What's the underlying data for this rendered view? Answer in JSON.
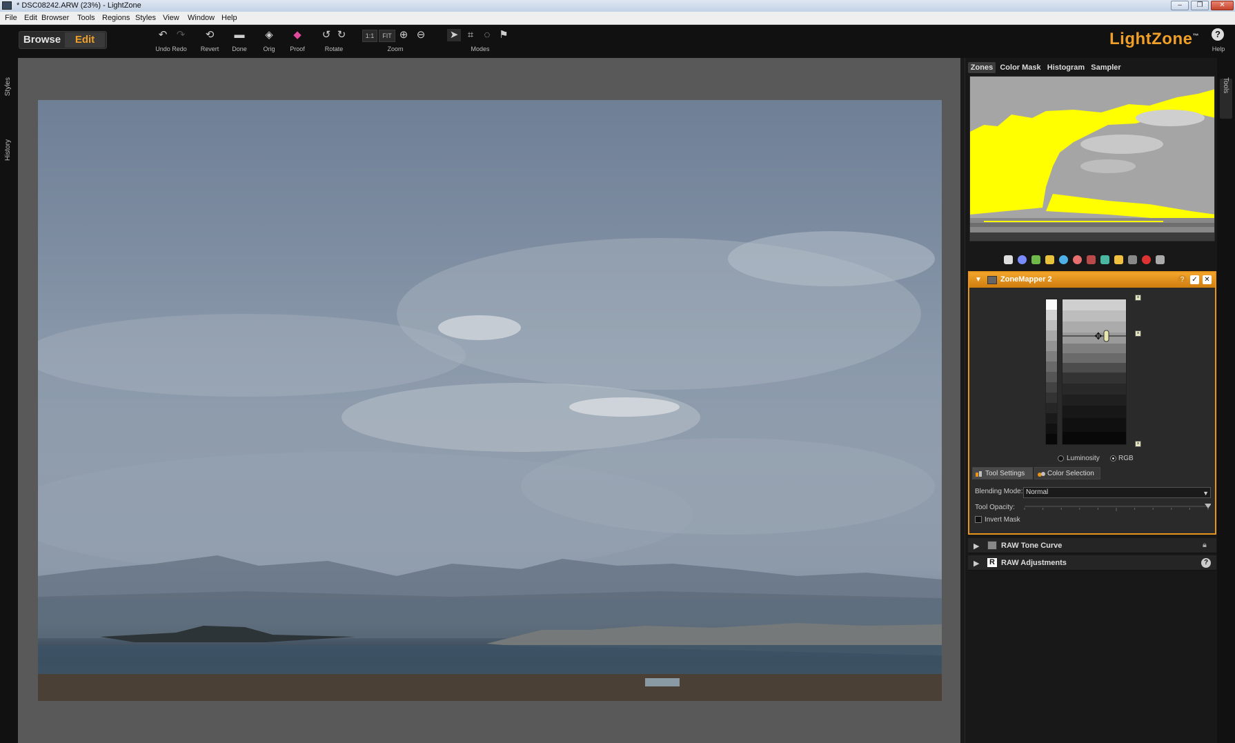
{
  "window": {
    "title": "* DSC08242.ARW (23%) - LightZone",
    "minimize": "–",
    "maximize": "❐",
    "close": "✕"
  },
  "menu": [
    "File",
    "Edit",
    "Browser",
    "Tools",
    "Regions",
    "Styles",
    "View",
    "Window",
    "Help"
  ],
  "toolbar": {
    "browse": "Browse",
    "edit": "Edit",
    "undo_redo": "Undo Redo",
    "revert": "Revert",
    "done": "Done",
    "orig": "Orig",
    "proof": "Proof",
    "rotate": "Rotate",
    "zoom_1to1": "1:1",
    "zoom_fit": "FIT",
    "zoom": "Zoom",
    "modes": "Modes",
    "brand": "LightZone",
    "brand_tm": "™",
    "help": "Help",
    "help_glyph": "?"
  },
  "left_rail": {
    "styles": "Styles",
    "history": "History"
  },
  "right_rail": {
    "tools": "Tools"
  },
  "panel_tabs": [
    "Zones",
    "Color Mask",
    "Histogram",
    "Sampler"
  ],
  "zonemapper": {
    "title": "ZoneMapper 2",
    "luminosity": "Luminosity",
    "rgb": "RGB",
    "mode_selected": "RGB",
    "tab_tool_settings": "Tool Settings",
    "tab_color_selection": "Color Selection",
    "blending_label": "Blending Mode:",
    "blending_value": "Normal",
    "opacity_label": "Tool Opacity:",
    "opacity_value": 1.0,
    "invert_label": "Invert Mask",
    "invert_checked": false,
    "enabled": true
  },
  "collapsed_tools": [
    {
      "label": "RAW Tone Curve",
      "icon": "tone-curve-icon",
      "right_icon": "lock-icon"
    },
    {
      "label": "RAW Adjustments",
      "icon": "raw-icon",
      "icon_letter": "R",
      "right_icon": "help-icon"
    }
  ],
  "colors": {
    "accent": "#f0a028",
    "zone_highlight": "#ffff00"
  }
}
